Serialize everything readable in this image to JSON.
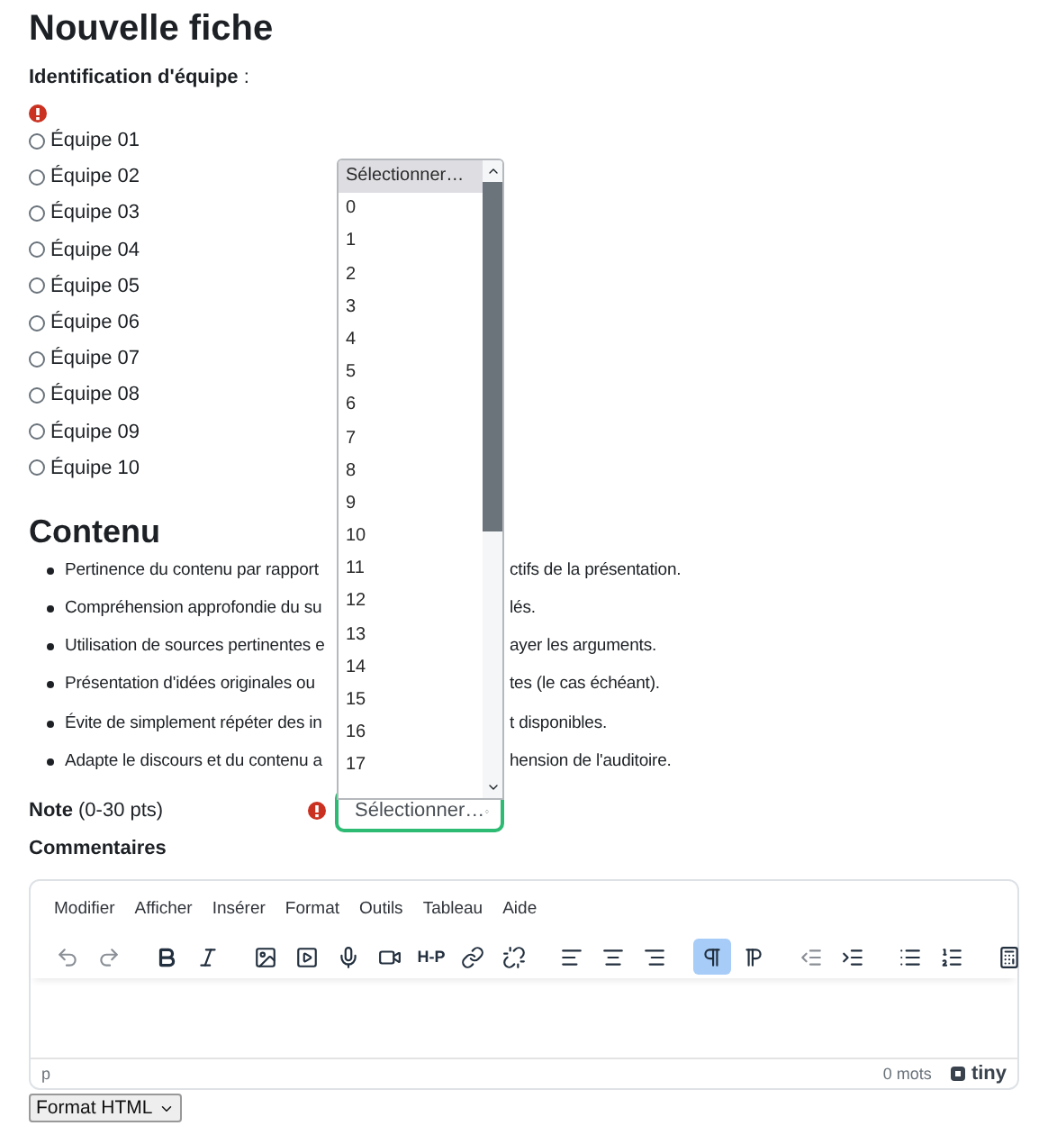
{
  "title": "Nouvelle fiche",
  "team": {
    "label": "Identification d'équipe",
    "suffix": " :",
    "required": true,
    "options": [
      {
        "label": "Équipe 01",
        "selected": false
      },
      {
        "label": "Équipe 02",
        "selected": false
      },
      {
        "label": "Équipe 03",
        "selected": false
      },
      {
        "label": "Équipe 04",
        "selected": false
      },
      {
        "label": "Équipe 05",
        "selected": false
      },
      {
        "label": "Équipe 06",
        "selected": false
      },
      {
        "label": "Équipe 07",
        "selected": false
      },
      {
        "label": "Équipe 08",
        "selected": false
      },
      {
        "label": "Équipe 09",
        "selected": false
      },
      {
        "label": "Équipe 10",
        "selected": false
      }
    ]
  },
  "section": "Contenu",
  "criteria": [
    {
      "left": "Pertinence du contenu par rapport",
      "right": "ctifs de la présentation."
    },
    {
      "left": "Compréhension approfondie du su",
      "right": "lés."
    },
    {
      "left": "Utilisation de sources pertinentes e",
      "right": "ayer les arguments."
    },
    {
      "left": "Présentation d'idées originales ou",
      "right": "tes (le cas échéant)."
    },
    {
      "left": "Évite de simplement répéter des in",
      "right": "t disponibles."
    },
    {
      "left": "Adapte le discours et du contenu a",
      "right": "hension de l'auditoire."
    }
  ],
  "grade": {
    "label": "Note",
    "hint": "(0-30 pts)",
    "required": true,
    "value": "Sélectionner…",
    "open_list": [
      {
        "label": "Sélectionner…",
        "selected": true
      },
      {
        "label": "0",
        "selected": false
      },
      {
        "label": "1",
        "selected": false
      },
      {
        "label": "2",
        "selected": false
      },
      {
        "label": "3",
        "selected": false
      },
      {
        "label": "4",
        "selected": false
      },
      {
        "label": "5",
        "selected": false
      },
      {
        "label": "6",
        "selected": false
      },
      {
        "label": "7",
        "selected": false
      },
      {
        "label": "8",
        "selected": false
      },
      {
        "label": "9",
        "selected": false
      },
      {
        "label": "10",
        "selected": false
      },
      {
        "label": "11",
        "selected": false
      },
      {
        "label": "12",
        "selected": false
      },
      {
        "label": "13",
        "selected": false
      },
      {
        "label": "14",
        "selected": false
      },
      {
        "label": "15",
        "selected": false
      },
      {
        "label": "16",
        "selected": false
      },
      {
        "label": "17",
        "selected": false
      }
    ]
  },
  "comments": {
    "label": "Commentaires",
    "menu": [
      "Modifier",
      "Afficher",
      "Insérer",
      "Format",
      "Outils",
      "Tableau",
      "Aide"
    ],
    "toolbar": [
      [
        {
          "kind": "undo",
          "disabled": true
        },
        {
          "kind": "redo",
          "disabled": true
        }
      ],
      [
        {
          "kind": "bold",
          "disabled": false
        },
        {
          "kind": "italic",
          "disabled": false
        }
      ],
      [
        {
          "kind": "image",
          "disabled": false
        },
        {
          "kind": "media",
          "disabled": false
        },
        {
          "kind": "mic",
          "disabled": false
        },
        {
          "kind": "video",
          "disabled": false
        },
        {
          "kind": "h5p",
          "label": "H-P",
          "disabled": false
        },
        {
          "kind": "link",
          "disabled": false
        },
        {
          "kind": "unlink",
          "disabled": false
        }
      ],
      [
        {
          "kind": "alignleft",
          "disabled": false
        },
        {
          "kind": "aligncenter",
          "disabled": false
        },
        {
          "kind": "alignright",
          "disabled": false
        }
      ],
      [
        {
          "kind": "ltr",
          "disabled": false,
          "selected": true
        },
        {
          "kind": "rtl",
          "disabled": false,
          "selected": false
        }
      ],
      [
        {
          "kind": "outdent",
          "disabled": true
        },
        {
          "kind": "indent",
          "disabled": false
        }
      ],
      [
        {
          "kind": "bullets",
          "disabled": false
        },
        {
          "kind": "numbers",
          "disabled": false
        }
      ],
      [
        {
          "kind": "calculator",
          "disabled": false
        }
      ]
    ],
    "path": "p",
    "word_count": "0 mots",
    "brand": "tiny"
  },
  "format": "Format HTML"
}
